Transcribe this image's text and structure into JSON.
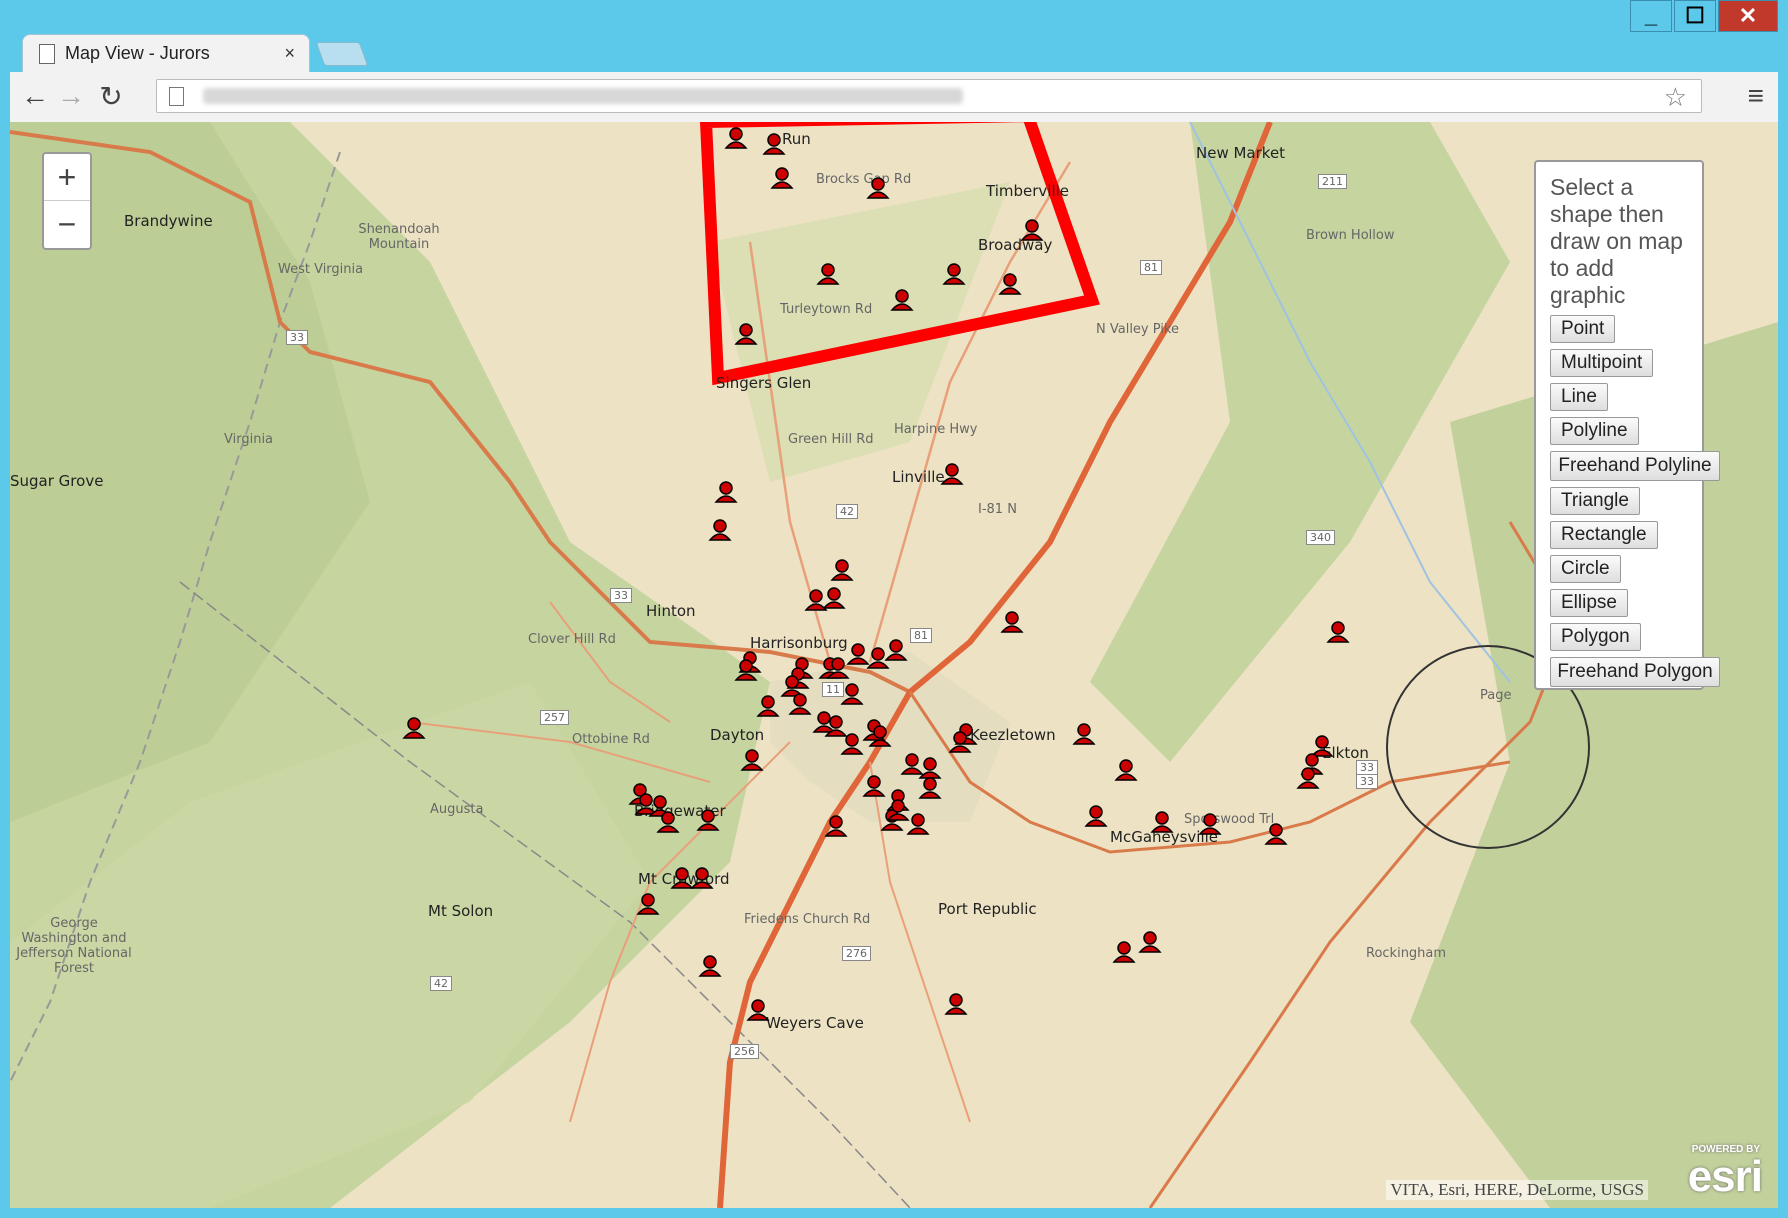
{
  "window": {
    "minimize_label": "_",
    "maximize_label": "☐",
    "close_label": "✕"
  },
  "tab": {
    "title": "Map View - Jurors",
    "close_label": "×"
  },
  "toolbar": {
    "back_label": "←",
    "forward_label": "→",
    "reload_label": "↻",
    "url": "",
    "star_label": "☆",
    "menu_label": "≡"
  },
  "map": {
    "zoom_in_label": "+",
    "zoom_out_label": "−",
    "labels": [
      "Run",
      "Brocks Gap Rd",
      "Timberville",
      "Broadway",
      "New Market",
      "Brandywine",
      "Shenandoah Mountain",
      "West Virginia",
      "Virginia",
      "Turleytown Rd",
      "Singers Glen",
      "Green Hill Rd",
      "Harpine Hwy",
      "Linville",
      "N Valley Pike",
      "I-81 N",
      "Hinton",
      "Clover Hill Rd",
      "Harrisonburg",
      "Dayton",
      "Ottobine Rd",
      "Bridgewater",
      "Keezletown",
      "Elkton",
      "McGaheysville",
      "Mt Crawford",
      "Mt Solon",
      "Port Republic",
      "Weyers Cave",
      "George Washington and Jefferson National Forest",
      "Friedens Church Rd",
      "Spotswood Trl",
      "Sugar Grove",
      "Brown Hollow",
      "Page",
      "Rockingham",
      "Augusta"
    ],
    "route_shields": [
      "33",
      "33",
      "33",
      "257",
      "42",
      "42",
      "81",
      "81",
      "11",
      "211",
      "340",
      "33",
      "276",
      "256"
    ],
    "attribution": "VITA, Esri, HERE, DeLorme, USGS",
    "logo_text": "esri",
    "logo_powered": "POWERED BY"
  },
  "panel": {
    "hint": "Select a shape then draw on map to add graphic",
    "buttons": {
      "point": "Point",
      "multipoint": "Multipoint",
      "line": "Line",
      "polyline": "Polyline",
      "freehand_polyline": "Freehand Polyline",
      "triangle": "Triangle",
      "rectangle": "Rectangle",
      "circle": "Circle",
      "ellipse": "Ellipse",
      "polygon": "Polygon",
      "freehand_polygon": "Freehand Polygon"
    }
  },
  "colors": {
    "polygon_stroke": "#ff0000",
    "marker": "#cc0000",
    "map_bg": "#ede3c4",
    "forest": "#c9d6a4",
    "road": "#e8a07a",
    "browser_frame": "#5cc8ea"
  }
}
